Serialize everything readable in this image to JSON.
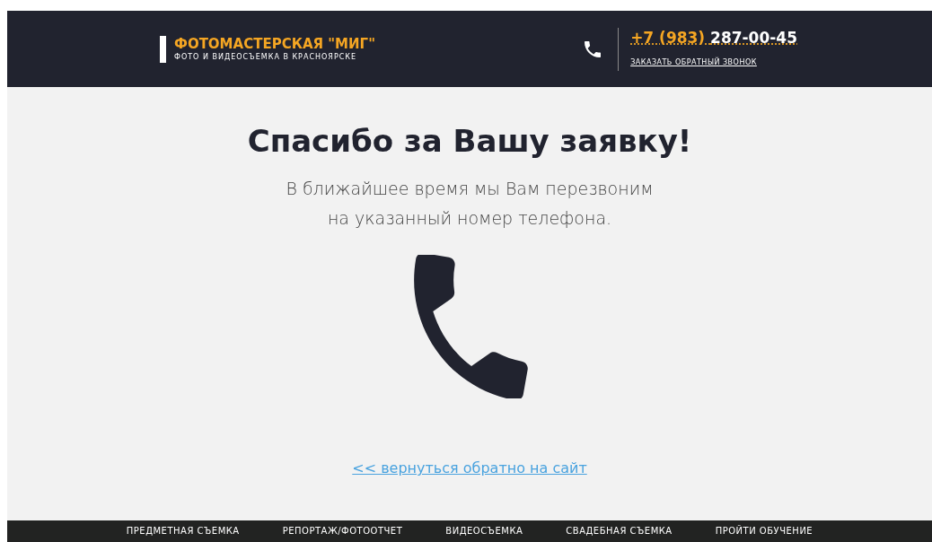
{
  "header": {
    "brand": "ФОТОМАСТЕРСКАЯ \"МИГ\"",
    "tagline": "ФОТО И ВИДЕОСЪЕМКА В КРАСНОЯРСКЕ",
    "phone": {
      "code": "+7 (983)",
      "number": "287-00-45"
    },
    "callback_link": "ЗАКАЗАТЬ ОБРАТНЫЙ ЗВОНОК"
  },
  "main": {
    "title": "Спасибо за Вашу заявку!",
    "message_lines": [
      "В ближайшее время мы Вам перезвоним",
      "на указанный номер телефона."
    ],
    "back_link": "<< вернуться обратно на сайт"
  },
  "footer_nav": [
    "ПРЕДМЕТНАЯ СЪЕМКА",
    "РЕПОРТАЖ/ФОТООТЧЕТ",
    "ВИДЕОСЪЕМКА",
    "СВАДЕБНАЯ СЪЕМКА",
    "ПРОЙТИ ОБУЧЕНИЕ"
  ]
}
